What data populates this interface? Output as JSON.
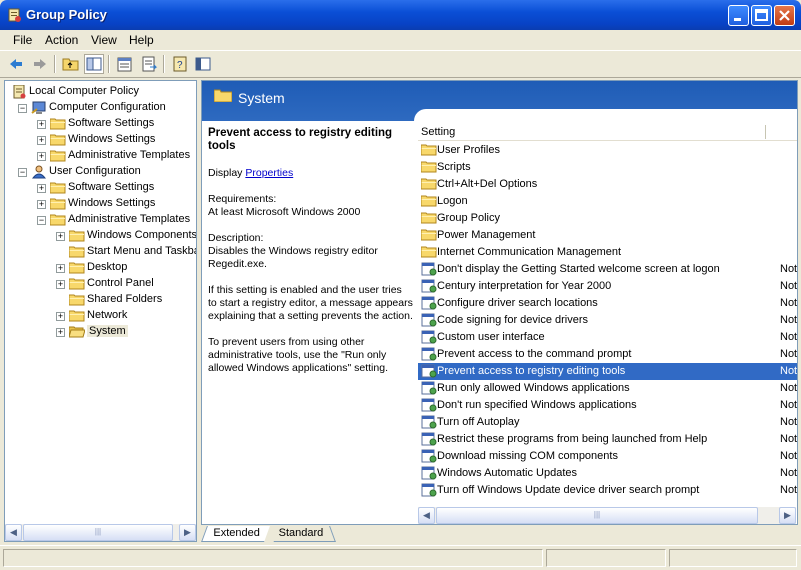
{
  "window": {
    "title": "Group Policy"
  },
  "menu": [
    "File",
    "Action",
    "View",
    "Help"
  ],
  "tree": {
    "items": [
      {
        "label": "Local Computer Policy",
        "level": 0,
        "icon": "policy-icon",
        "expander": ""
      },
      {
        "label": "Computer Configuration",
        "level": 1,
        "icon": "computer-icon",
        "expander": "−"
      },
      {
        "label": "Software Settings",
        "level": 2,
        "icon": "folder-icon",
        "expander": "+"
      },
      {
        "label": "Windows Settings",
        "level": 2,
        "icon": "folder-icon",
        "expander": "+"
      },
      {
        "label": "Administrative Templates",
        "level": 2,
        "icon": "folder-icon",
        "expander": "+"
      },
      {
        "label": "User Configuration",
        "level": 1,
        "icon": "user-icon",
        "expander": "−"
      },
      {
        "label": "Software Settings",
        "level": 2,
        "icon": "folder-icon",
        "expander": "+"
      },
      {
        "label": "Windows Settings",
        "level": 2,
        "icon": "folder-icon",
        "expander": "+"
      },
      {
        "label": "Administrative Templates",
        "level": 2,
        "icon": "folder-icon",
        "expander": "−"
      },
      {
        "label": "Windows Components",
        "level": 3,
        "icon": "folder-icon",
        "expander": "+"
      },
      {
        "label": "Start Menu and Taskba",
        "level": 3,
        "icon": "folder-icon",
        "expander": ""
      },
      {
        "label": "Desktop",
        "level": 3,
        "icon": "folder-icon",
        "expander": "+"
      },
      {
        "label": "Control Panel",
        "level": 3,
        "icon": "folder-icon",
        "expander": "+"
      },
      {
        "label": "Shared Folders",
        "level": 3,
        "icon": "folder-icon",
        "expander": ""
      },
      {
        "label": "Network",
        "level": 3,
        "icon": "folder-icon",
        "expander": "+"
      },
      {
        "label": "System",
        "level": 3,
        "icon": "open-folder-icon",
        "expander": "+"
      }
    ]
  },
  "header": {
    "title": "System"
  },
  "description": {
    "title": "Prevent access to registry editing tools",
    "display_prefix": "Display",
    "display_link": "Properties",
    "requirements_label": "Requirements:",
    "requirements_value": "At least Microsoft Windows 2000",
    "description_label": "Description:",
    "description_value": "Disables the Windows registry editor Regedit.exe.",
    "para1": "If this setting is enabled and the user tries to start a registry editor, a message appears explaining that a setting prevents the action.",
    "para2": "To prevent users from using other administrative tools, use the \"Run only allowed Windows applications\" setting."
  },
  "list": {
    "column_setting": "Setting",
    "rows": [
      {
        "label": "User Profiles",
        "icon": "folder-icon",
        "state": ""
      },
      {
        "label": "Scripts",
        "icon": "folder-icon",
        "state": ""
      },
      {
        "label": "Ctrl+Alt+Del Options",
        "icon": "folder-icon",
        "state": ""
      },
      {
        "label": "Logon",
        "icon": "folder-icon",
        "state": ""
      },
      {
        "label": "Group Policy",
        "icon": "folder-icon",
        "state": ""
      },
      {
        "label": "Power Management",
        "icon": "folder-icon",
        "state": ""
      },
      {
        "label": "Internet Communication Management",
        "icon": "folder-icon",
        "state": ""
      },
      {
        "label": "Don't display the Getting Started welcome screen at logon",
        "icon": "setting-icon",
        "state": "Not"
      },
      {
        "label": "Century interpretation for Year 2000",
        "icon": "setting-icon",
        "state": "Not"
      },
      {
        "label": "Configure driver search locations",
        "icon": "setting-icon",
        "state": "Not"
      },
      {
        "label": "Code signing for device drivers",
        "icon": "setting-icon",
        "state": "Not"
      },
      {
        "label": "Custom user interface",
        "icon": "setting-icon",
        "state": "Not"
      },
      {
        "label": "Prevent access to the command prompt",
        "icon": "setting-icon",
        "state": "Not"
      },
      {
        "label": "Prevent access to registry editing tools",
        "icon": "setting-icon",
        "state": "Not",
        "selected": true
      },
      {
        "label": "Run only allowed Windows applications",
        "icon": "setting-icon",
        "state": "Not"
      },
      {
        "label": "Don't run specified Windows applications",
        "icon": "setting-icon",
        "state": "Not"
      },
      {
        "label": "Turn off Autoplay",
        "icon": "setting-icon",
        "state": "Not"
      },
      {
        "label": "Restrict these programs from being launched from Help",
        "icon": "setting-icon",
        "state": "Not"
      },
      {
        "label": "Download missing COM components",
        "icon": "setting-icon",
        "state": "Not"
      },
      {
        "label": "Windows Automatic Updates",
        "icon": "setting-icon",
        "state": "Not"
      },
      {
        "label": "Turn off Windows Update device driver search prompt",
        "icon": "setting-icon",
        "state": "Not"
      }
    ]
  },
  "tabs": {
    "extended": "Extended",
    "standard": "Standard"
  },
  "colors": {
    "titlebar": "#0A4FD6",
    "selection": "#316AC5",
    "header_band": "#2A64BA",
    "link": "#0000CC"
  }
}
